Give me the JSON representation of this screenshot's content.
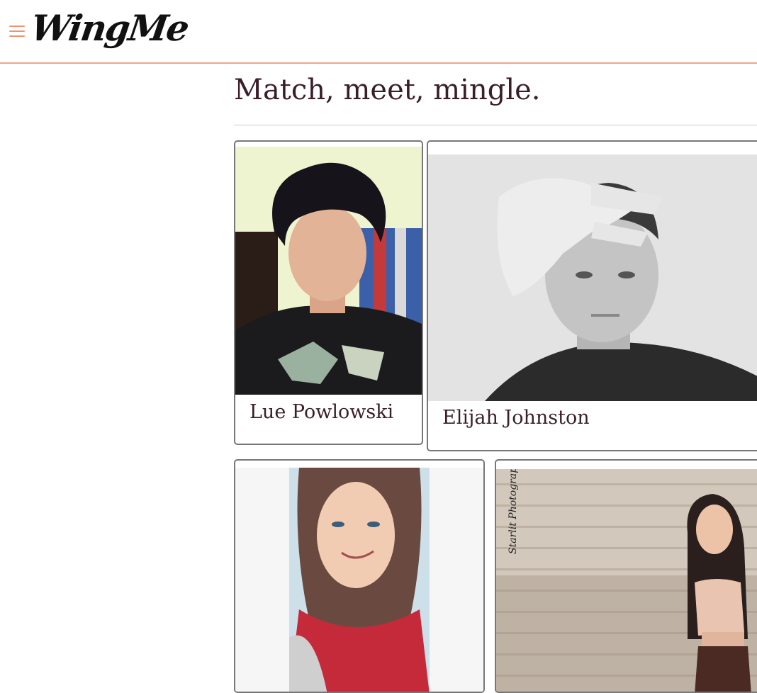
{
  "header": {
    "logo_text": "WingMe",
    "menu_icon": "hamburger-menu-icon",
    "accent_color": "#f0946f"
  },
  "main": {
    "heading": "Match, meet, mingle."
  },
  "profiles": [
    {
      "name": "Lue Powlowski"
    },
    {
      "name": "Elijah Johnston"
    },
    {
      "name": ""
    },
    {
      "name": ""
    }
  ],
  "photo_overlay_text": "Starlit Photography"
}
